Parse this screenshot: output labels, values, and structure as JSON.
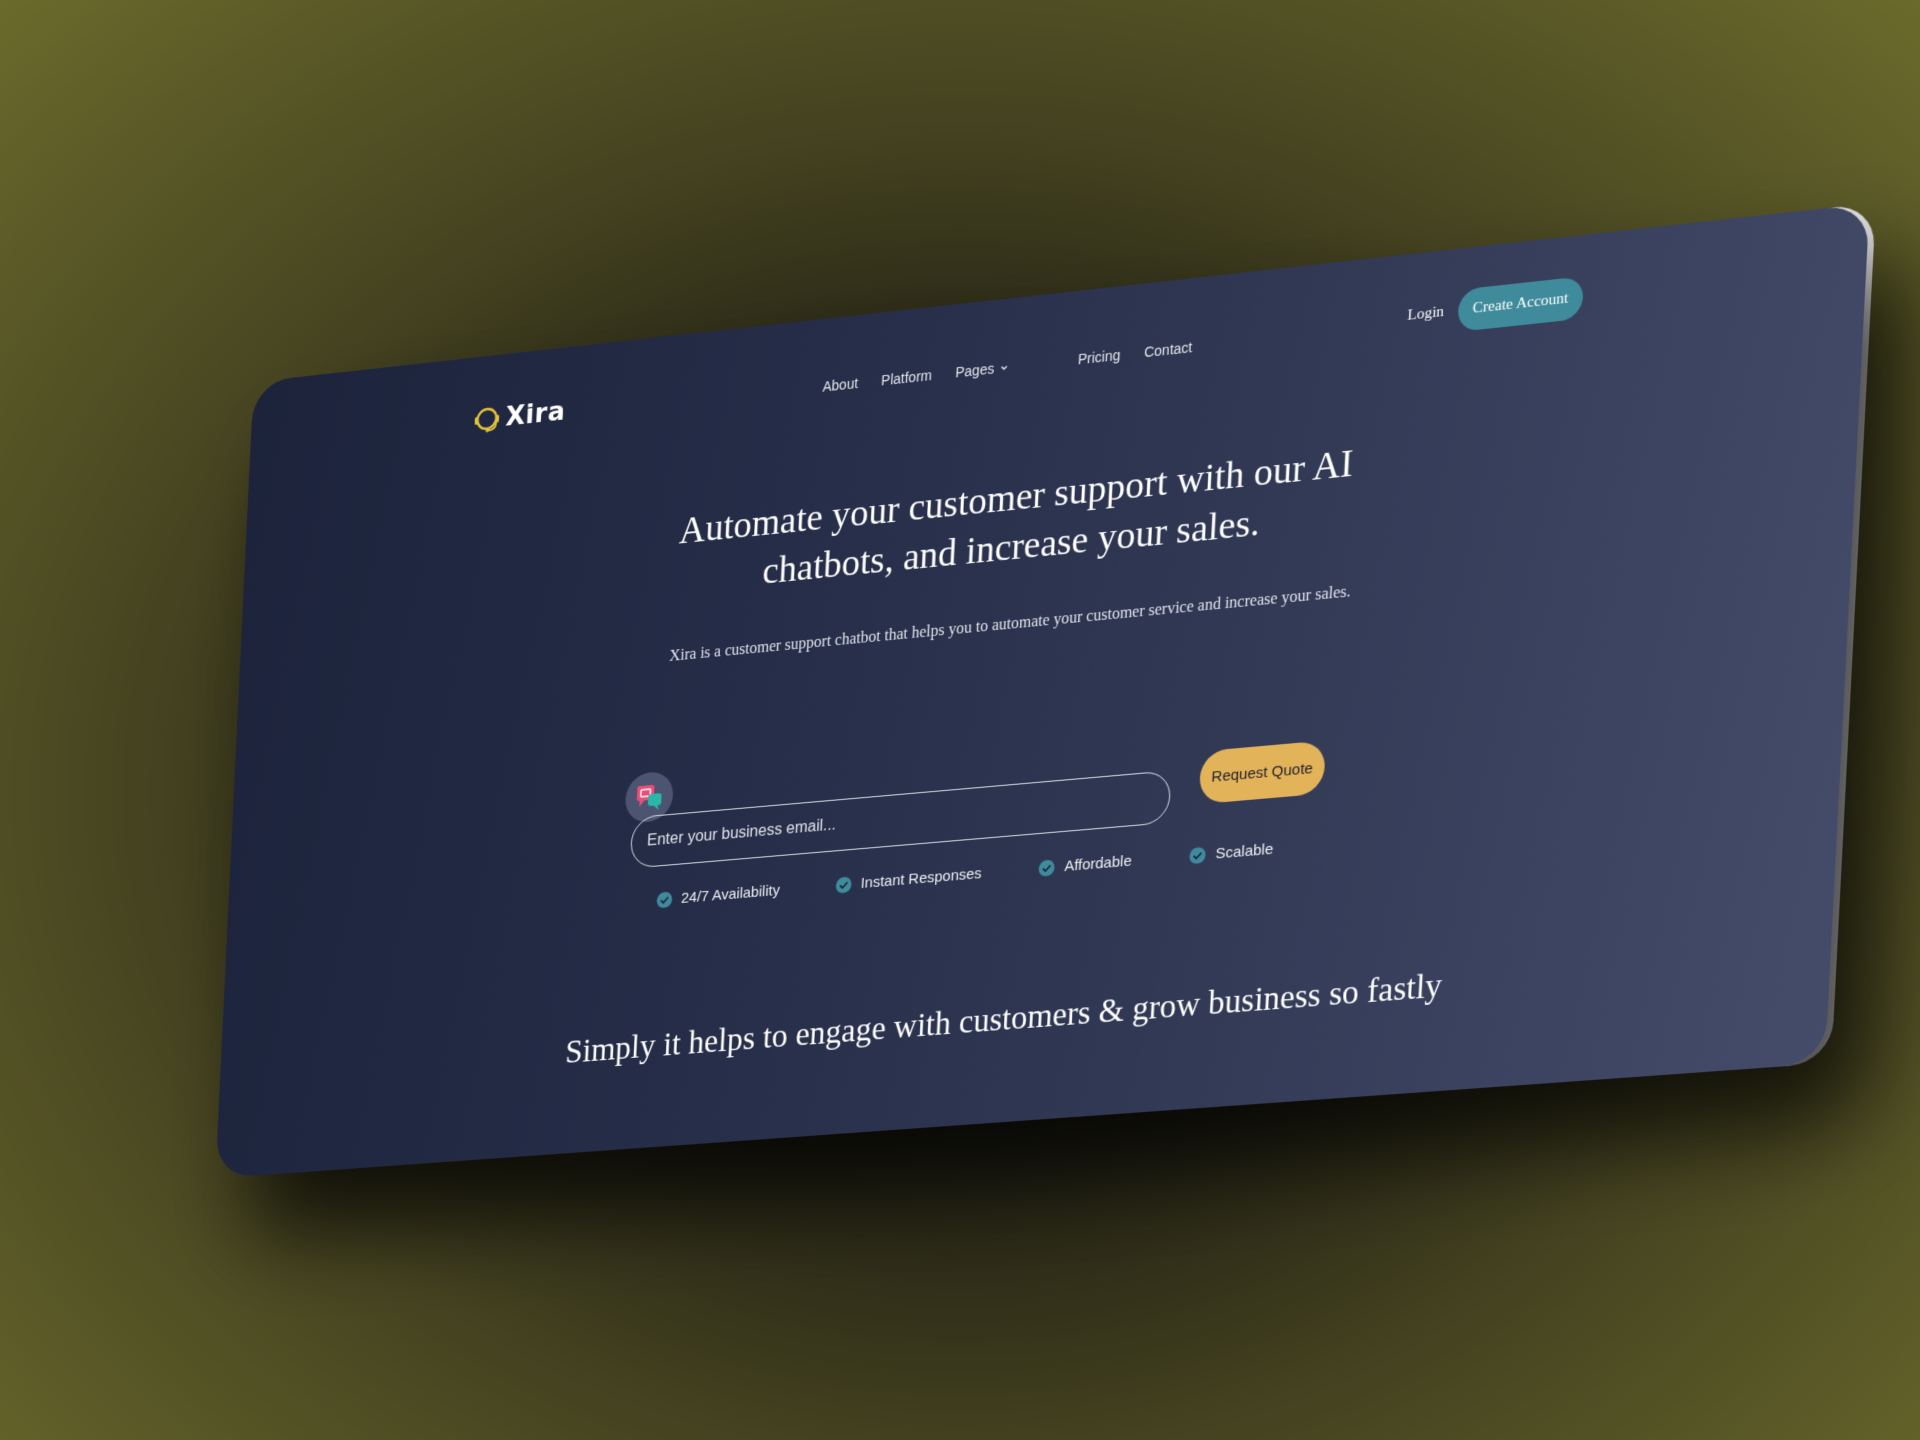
{
  "brand": {
    "name": "Xira",
    "color": "#e2c23a"
  },
  "nav": {
    "items": [
      "About",
      "Platform",
      "Pages",
      "Pricing",
      "Contact"
    ],
    "login_label": "Login",
    "create_account_label": "Create Account"
  },
  "hero": {
    "title": "Automate your customer support with our AI chatbots, and increase your sales.",
    "subtitle": "Xira is a customer support chatbot that helps you to automate your customer service and increase your sales."
  },
  "form": {
    "email_placeholder": "Enter your business email...",
    "email_value": "",
    "request_quote_label": "Request Quote"
  },
  "features": [
    "24/7 Availability",
    "Instant Responses",
    "Affordable",
    "Scalable"
  ],
  "section": {
    "title": "Simply it helps to engage with customers & grow business so fastly"
  },
  "colors": {
    "accent_teal": "#3f8b9c",
    "accent_gold": "#e3b35a",
    "check": "#3f8b9c"
  },
  "icons": {
    "logo": "headset-icon",
    "pages_dropdown": "chevron-down-icon",
    "chat": "chat-bubbles-icon",
    "feature": "check-circle-icon"
  }
}
